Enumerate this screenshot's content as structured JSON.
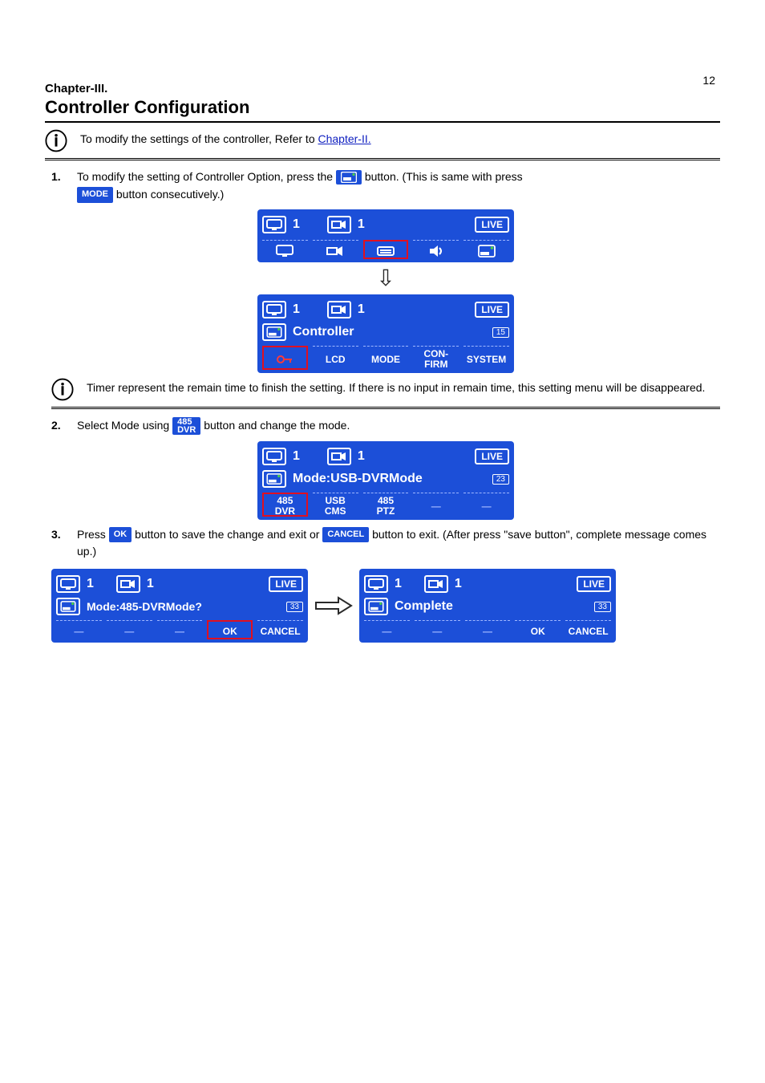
{
  "page_number": "12",
  "chapter_super": "Chapter-III.",
  "chapter_title": "Controller Configuration",
  "info1": {
    "prefix": "To modify the settings of the controller, Refer to ",
    "link": "Chapter-II.",
    "suffix": ""
  },
  "step1": {
    "n": "1.",
    "p1_a": "To modify the setting of Controller Option, press the ",
    "badge1_name": "controller-badge",
    "p1_b": " button. (This is same with press",
    "p2_badge": "MODE",
    "p2_after": " button consecutively.)"
  },
  "lcd_top": {
    "monitor_num": "1",
    "cam_num": "1",
    "status": "LIVE"
  },
  "lcd_ctrl": {
    "monitor_num": "1",
    "cam_num": "1",
    "status": "LIVE",
    "label": "Controller",
    "timer": "15",
    "soft": [
      "",
      "LCD",
      "MODE",
      "CON-\nFIRM",
      "SYSTEM"
    ],
    "soft_icon0": "key-icon"
  },
  "info2_text": "Timer represent the remain time to finish the setting. If there is no input in remain time, this setting menu will be disappeared.",
  "step2": {
    "n": "2.",
    "p": "Select Mode using ",
    "badge": "485\nDVR",
    "after": " button and change the mode."
  },
  "lcd_mode": {
    "monitor_num": "1",
    "cam_num": "1",
    "status": "LIVE",
    "label": "Mode:USB-DVRMode",
    "timer": "23",
    "soft": [
      "485\nDVR",
      "USB\nCMS",
      "485\nPTZ",
      "",
      ""
    ]
  },
  "step3": {
    "n": "3.",
    "p1": "Press ",
    "badge1": "OK",
    "p2": " button to save the change and exit or ",
    "badge2": "CANCEL",
    "p3": " button to exit. (After press \"save button\", complete message comes up.)"
  },
  "lcd_confirm": {
    "monitor_num": "1",
    "cam_num": "1",
    "status": "LIVE",
    "label": "Mode:485-DVRMode?",
    "timer": "33",
    "soft": [
      "",
      "",
      "",
      "OK",
      "CANCEL"
    ]
  },
  "lcd_complete": {
    "monitor_num": "1",
    "cam_num": "1",
    "status": "LIVE",
    "label": "Complete",
    "timer": "33",
    "soft": [
      "",
      "",
      "",
      "OK",
      "CANCEL"
    ]
  },
  "icon_labels": {
    "monitor": "monitor-icon",
    "camera": "camera-icon",
    "keyboard": "keyboard-icon",
    "sound": "sound-icon",
    "controller": "controller-icon",
    "key": "key-icon",
    "gear": "gear-icon"
  }
}
